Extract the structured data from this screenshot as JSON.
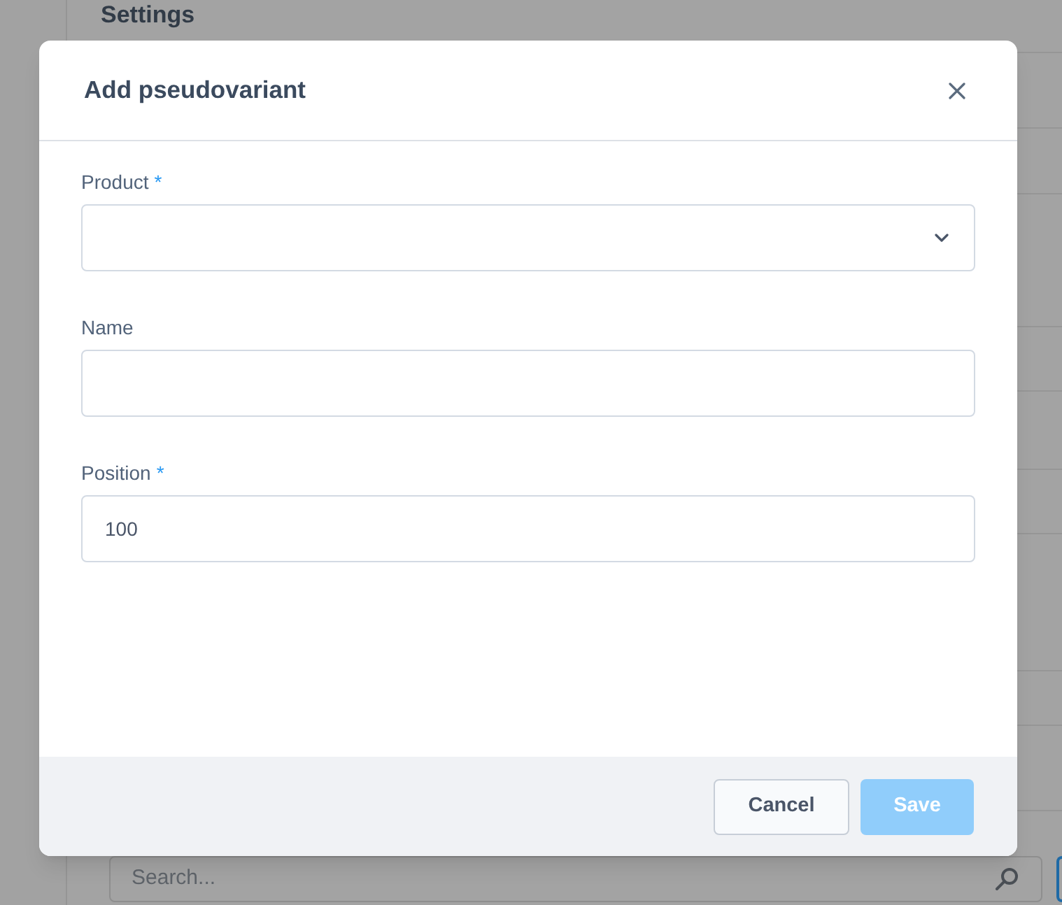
{
  "background": {
    "heading": "Settings",
    "search": {
      "placeholder": "Search..."
    }
  },
  "dialog": {
    "title": "Add pseudovariant",
    "fields": [
      {
        "kind": "select",
        "label": "Product",
        "mark": "*"
      },
      {
        "kind": "text",
        "label": "Name"
      },
      {
        "kind": "text",
        "label": "Position",
        "mark": "*",
        "value": "100"
      }
    ],
    "buttons": [
      {
        "label": "Cancel",
        "kind": "secondary",
        "disabled": false
      },
      {
        "label": "Save",
        "kind": "primary",
        "disabled": true
      }
    ]
  }
}
